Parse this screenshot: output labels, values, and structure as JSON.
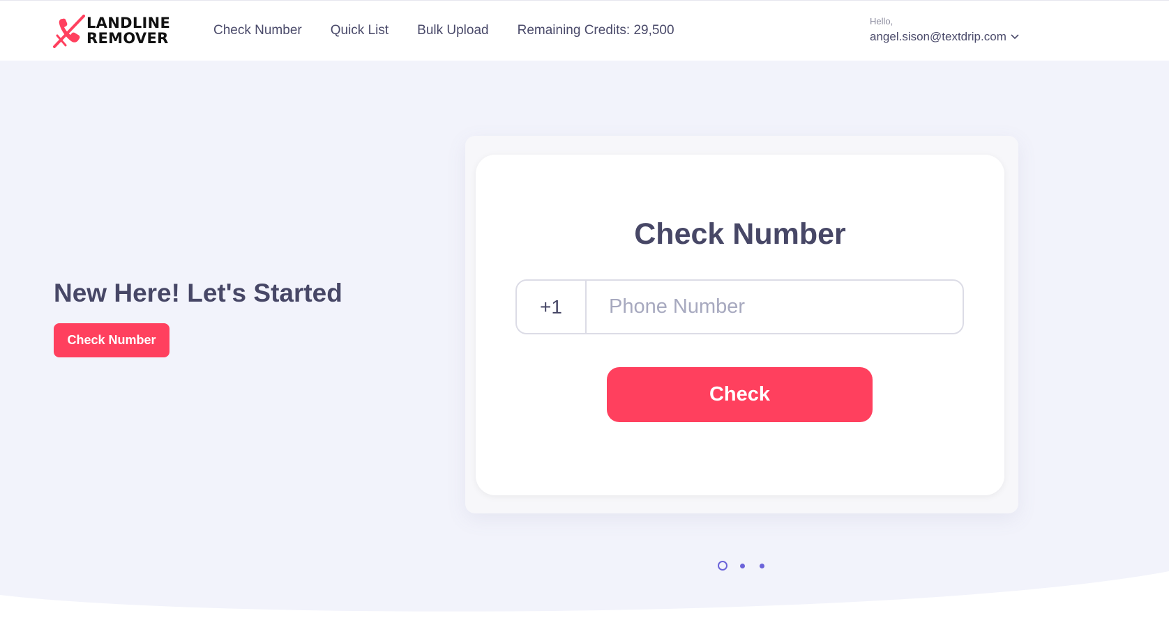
{
  "logo": {
    "line1": "LANDLINE",
    "line2": "REMOVER",
    "accent_color": "#ff405e",
    "icon": "crossed-phone-icon"
  },
  "nav": {
    "items": [
      {
        "label": "Check Number"
      },
      {
        "label": "Quick List"
      },
      {
        "label": "Bulk Upload"
      }
    ],
    "credits": "Remaining Credits: 29,500"
  },
  "user": {
    "greeting": "Hello,",
    "email": "angel.sison@textdrip.com",
    "icon": "chevron-down-icon"
  },
  "hero": {
    "title": "New Here! Let's Started",
    "button_label": "Check Number"
  },
  "card": {
    "title": "Check Number",
    "country_code": "+1",
    "phone_placeholder": "Phone Number",
    "phone_value": "",
    "button_label": "Check"
  },
  "carousel": {
    "slide_count": 3,
    "active_index": 0
  },
  "colors": {
    "brand": "#ff405e",
    "background": "#f2f3fb",
    "text": "#474766",
    "dots": "#6b63d9"
  }
}
